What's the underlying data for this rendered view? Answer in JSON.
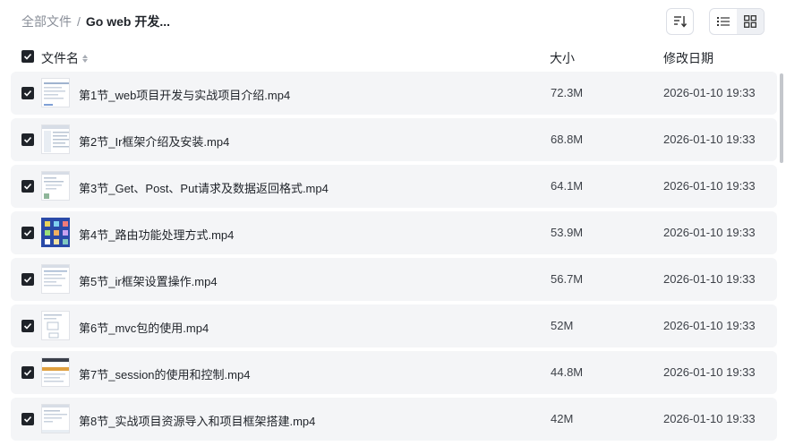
{
  "breadcrumb": {
    "root": "全部文件",
    "separator": "/",
    "current": "Go web 开发..."
  },
  "toolbar": {
    "sort_icon": "sort-lines-icon",
    "list_view_icon": "list-view-icon",
    "grid_view_icon": "grid-view-icon"
  },
  "header": {
    "name": "文件名",
    "size": "大小",
    "date": "修改日期"
  },
  "files": [
    {
      "name": "第1节_web项目开发与实战项目介绍.mp4",
      "size": "72.3M",
      "date": "2026-01-10 19:33"
    },
    {
      "name": "第2节_Ir框架介绍及安装.mp4",
      "size": "68.8M",
      "date": "2026-01-10 19:33"
    },
    {
      "name": "第3节_Get、Post、Put请求及数据返回格式.mp4",
      "size": "64.1M",
      "date": "2026-01-10 19:33"
    },
    {
      "name": "第4节_路由功能处理方式.mp4",
      "size": "53.9M",
      "date": "2026-01-10 19:33"
    },
    {
      "name": "第5节_ir框架设置操作.mp4",
      "size": "56.7M",
      "date": "2026-01-10 19:33"
    },
    {
      "name": "第6节_mvc包的使用.mp4",
      "size": "52M",
      "date": "2026-01-10 19:33"
    },
    {
      "name": "第7节_session的使用和控制.mp4",
      "size": "44.8M",
      "date": "2026-01-10 19:33"
    },
    {
      "name": "第8节_实战项目资源导入和项目框架搭建.mp4",
      "size": "42M",
      "date": "2026-01-10 19:33"
    }
  ],
  "colors": {
    "accent": "#1f2329",
    "row_bg": "#f4f5f7",
    "muted": "#8a8f99"
  }
}
